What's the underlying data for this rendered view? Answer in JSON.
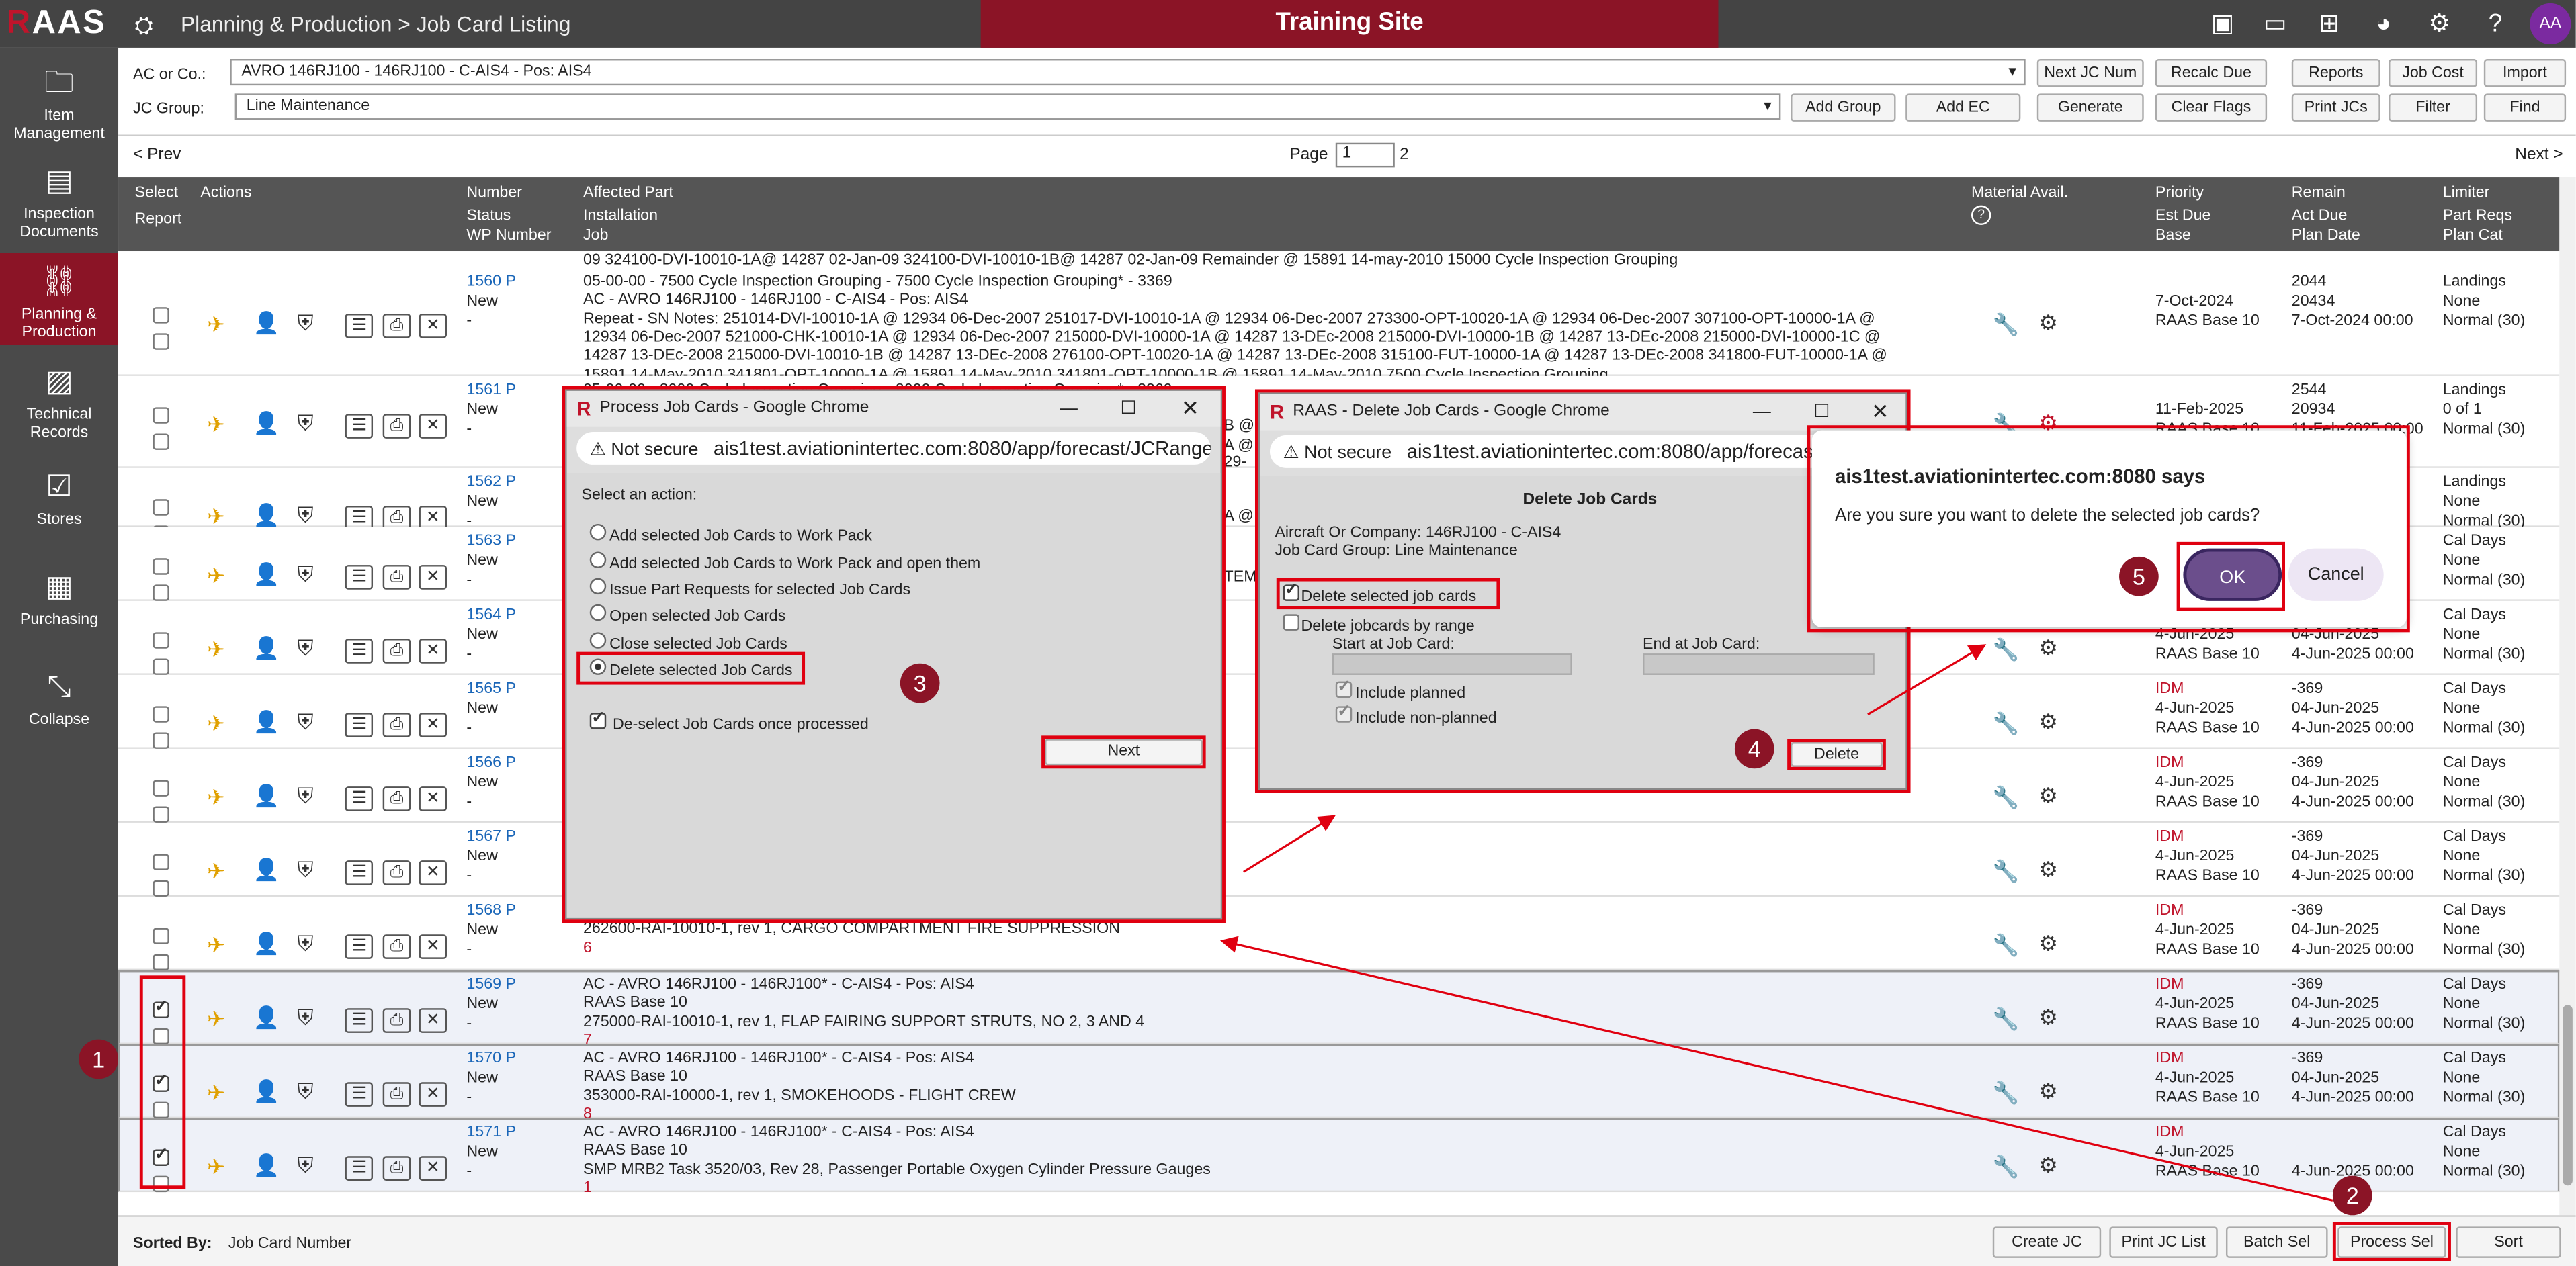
{
  "app": {
    "logo": "RAAS",
    "crumb": "Planning & Production > Job Card Listing",
    "training": "Training Site",
    "avatar": "AA"
  },
  "sidebar": [
    {
      "label1": "Item",
      "label2": "Management",
      "icon": "folder-icon"
    },
    {
      "label1": "Inspection",
      "label2": "Documents",
      "icon": "document-icon"
    },
    {
      "label1": "Planning &",
      "label2": "Production",
      "icon": "network-icon"
    },
    {
      "label1": "Technical",
      "label2": "Records",
      "icon": "chart-icon"
    },
    {
      "label1": "Stores",
      "label2": "",
      "icon": "clipboard-icon"
    },
    {
      "label1": "Purchasing",
      "label2": "",
      "icon": "calculator-icon"
    },
    {
      "label1": "Collapse",
      "label2": "",
      "icon": "collapse-icon"
    }
  ],
  "filters": {
    "ac_label": "AC or Co.:",
    "ac_value": "AVRO 146RJ100 - 146RJ100 - C-AIS4 - Pos: AIS4",
    "jc_label": "JC Group:",
    "jc_value": "Line Maintenance",
    "buttons": [
      "Next JC Num",
      "Recalc Due",
      "Reports",
      "Job Cost",
      "Import",
      "Add Group",
      "Add EC",
      "Generate",
      "Clear Flags",
      "Print JCs",
      "Filter",
      "Find"
    ]
  },
  "pager": {
    "prev": "< Prev",
    "next": "Next >",
    "page_label": "Page",
    "page": "1",
    "total": "2"
  },
  "header": {
    "select": "Select",
    "actions": "Actions",
    "report": "Report",
    "number": "Number",
    "status": "Status",
    "wp": "WP Number",
    "affected": "Affected Part",
    "installation": "Installation",
    "job": "Job",
    "material": "Material Avail.",
    "help": "?",
    "priority": "Priority",
    "estdue": "Est Due",
    "base": "Base",
    "remain": "Remain",
    "actdue": "Act Due",
    "plandate": "Plan Date",
    "limiter": "Limiter",
    "partreqs": "Part Reqs",
    "plancat": "Plan Cat"
  },
  "toptext": "09 324100-DVI-10010-1A@ 14287 02-Jan-09 324100-DVI-10010-1B@ 14287 02-Jan-09 Remainder @ 15891 14-may-2010 15000 Cycle Inspection Grouping",
  "rows": [
    {
      "num": "1560 P",
      "status": "New",
      "wp": "-",
      "lines": [
        "05-00-00 - 7500 Cycle Inspection Grouping - 7500 Cycle Inspection Grouping* - 3369",
        "AC - AVRO 146RJ100 - 146RJ100 - C-AIS4 - Pos: AIS4",
        "Repeat - SN Notes: 251014-DVI-10010-1A @ 12934 06-Dec-2007 251017-DVI-10010-1A @ 12934 06-Dec-2007 273300-OPT-10020-1A @ 12934 06-Dec-2007 307100-OPT-10000-1A @",
        "12934 06-Dec-2007 521000-CHK-10010-1A @ 12934 06-Dec-2007 215000-DVI-10000-1A @ 14287 13-DEc-2008 215000-DVI-10000-1B @ 14287 13-DEc-2008 215000-DVI-10000-1C @",
        "14287 13-DEc-2008 215000-DVI-10010-1B @ 14287 13-DEc-2008 276100-OPT-10020-1A @ 14287 13-DEc-2008 315100-FUT-10000-1A @ 14287 13-DEc-2008 341800-FUT-10000-1A @",
        "15891 14-May-2010 341801-OPT-10000-1A @ 15891 14-May-2010 341801-OPT-10000-1B @ 15891 14-May-2010 7500 Cycle Inspection Grouping"
      ],
      "pri": "",
      "due": "7-Oct-2024",
      "base": "RAAS Base 10",
      "rem": "2044",
      "act": "20434",
      "plan": "7-Oct-2024 00:00",
      "lim": "Landings",
      "preq": "None",
      "pcat": "Normal (30)"
    },
    {
      "num": "1561 P",
      "status": "New",
      "wp": "-",
      "lines": [
        "05-00-00 - 8000 Cycle Inspection Grouping - 8000 Cycle Inspection Grouping* - 3369"
      ],
      "pri": "",
      "due": "11-Feb-2025",
      "base": "RAAS Base 10",
      "rem": "2544",
      "act": "20934",
      "plan": "11-Feb-2025 00:00",
      "lim": "Landings",
      "preq": "0 of 1",
      "pcat": "Normal (30)"
    },
    {
      "num": "1562 P",
      "status": "New",
      "wp": "-",
      "lines": [],
      "pri": "",
      "due": "",
      "base": "",
      "rem": "",
      "act": "",
      "plan": "",
      "lim": "Landings",
      "preq": "None",
      "pcat": "Normal (30)"
    },
    {
      "num": "1563 P",
      "status": "New",
      "wp": "-",
      "lines": [],
      "pri": "",
      "due": "",
      "base": "",
      "rem": "",
      "act": "",
      "plan": "",
      "lim": "Cal Days",
      "preq": "None",
      "pcat": "Normal (30)"
    },
    {
      "num": "1564 P",
      "status": "New",
      "wp": "-",
      "lines": [],
      "pri": "",
      "due": "4-Jun-2025",
      "base": "RAAS Base 10",
      "rem": "",
      "act": "04-Jun-2025",
      "plan": "4-Jun-2025 00:00",
      "lim": "Cal Days",
      "preq": "None",
      "pcat": "Normal (30)"
    },
    {
      "num": "1565 P",
      "status": "New",
      "wp": "-",
      "lines": [],
      "pri": "IDM",
      "due": "4-Jun-2025",
      "base": "RAAS Base 10",
      "rem": "-369",
      "act": "04-Jun-2025",
      "plan": "4-Jun-2025 00:00",
      "lim": "Cal Days",
      "preq": "None",
      "pcat": "Normal (30)"
    },
    {
      "num": "1566 P",
      "status": "New",
      "wp": "-",
      "lines": [],
      "pri": "IDM",
      "due": "4-Jun-2025",
      "base": "RAAS Base 10",
      "rem": "-369",
      "act": "04-Jun-2025",
      "plan": "4-Jun-2025 00:00",
      "lim": "Cal Days",
      "preq": "None",
      "pcat": "Normal (30)"
    },
    {
      "num": "1567 P",
      "status": "New",
      "wp": "-",
      "lines": [],
      "pri": "IDM",
      "due": "4-Jun-2025",
      "base": "RAAS Base 10",
      "rem": "-369",
      "act": "04-Jun-2025",
      "plan": "4-Jun-2025 00:00",
      "lim": "Cal Days",
      "preq": "None",
      "pcat": "Normal (30)"
    },
    {
      "num": "1568 P",
      "status": "New",
      "wp": "-",
      "lines": [
        "RAAS Base 10",
        "262600-RAI-10010-1, rev 1, CARGO COMPARTMENT FIRE SUPPRESSION",
        "6"
      ],
      "pri": "IDM",
      "due": "4-Jun-2025",
      "base": "RAAS Base 10",
      "rem": "-369",
      "act": "04-Jun-2025",
      "plan": "4-Jun-2025 00:00",
      "lim": "Cal Days",
      "preq": "None",
      "pcat": "Normal (30)"
    },
    {
      "num": "1569 P",
      "status": "New",
      "wp": "-",
      "lines": [
        "AC - AVRO 146RJ100 - 146RJ100* - C-AIS4 - Pos: AIS4",
        "RAAS Base 10",
        "275000-RAI-10010-1, rev 1, FLAP FAIRING SUPPORT STRUTS, NO 2, 3 AND 4",
        "7"
      ],
      "pri": "IDM",
      "due": "4-Jun-2025",
      "base": "RAAS Base 10",
      "rem": "-369",
      "act": "04-Jun-2025",
      "plan": "4-Jun-2025 00:00",
      "lim": "Cal Days",
      "preq": "None",
      "pcat": "Normal (30)"
    },
    {
      "num": "1570 P",
      "status": "New",
      "wp": "-",
      "lines": [
        "AC - AVRO 146RJ100 - 146RJ100* - C-AIS4 - Pos: AIS4",
        "RAAS Base 10",
        "353000-RAI-10000-1, rev 1, SMOKEHOODS - FLIGHT CREW",
        "8"
      ],
      "pri": "IDM",
      "due": "4-Jun-2025",
      "base": "RAAS Base 10",
      "rem": "-369",
      "act": "04-Jun-2025",
      "plan": "4-Jun-2025 00:00",
      "lim": "Cal Days",
      "preq": "None",
      "pcat": "Normal (30)"
    },
    {
      "num": "1571 P",
      "status": "New",
      "wp": "-",
      "lines": [
        "AC - AVRO 146RJ100 - 146RJ100* - C-AIS4 - Pos: AIS4",
        "RAAS Base 10",
        "SMP MRB2 Task 3520/03, Rev 28, Passenger Portable Oxygen Cylinder Pressure Gauges",
        "1"
      ],
      "pri": "IDM",
      "due": "4-Jun-2025",
      "base": "RAAS Base 10",
      "rem": "",
      "act": "",
      "plan": "4-Jun-2025 00:00",
      "lim": "Cal Days",
      "preq": "None",
      "pcat": "Normal (30)"
    }
  ],
  "partial": {
    "a": "B @",
    "b": "A @",
    "c": "29-",
    "d": "A @",
    "e": "TEM",
    "f": "05-00-00 - 8000 Cycle Inspection Grouping - 8000 Cycle Inspection Grouping* - 3369"
  },
  "bottom": {
    "sorted_label": "Sorted By:",
    "sorted_value": "Job Card Number",
    "buttons": [
      "Create JC",
      "Print JC List",
      "Batch Sel",
      "Process Sel",
      "Sort"
    ]
  },
  "dlg1": {
    "title": "Process Job Cards - Google Chrome",
    "secure": "Not secure",
    "url": "ais1test.aviationintertec.com:8080/app/forecast/JCRange...",
    "prompt": "Select an action:",
    "options": [
      "Add selected Job Cards to Work Pack",
      "Add selected Job Cards to Work Pack and open them",
      "Issue Part Requests for selected Job Cards",
      "Open selected Job Cards",
      "Close selected Job Cards",
      "Delete selected Job Cards"
    ],
    "deselect": "De-select Job Cards once processed",
    "next": "Next"
  },
  "dlg2": {
    "title": "RAAS - Delete Job Cards - Google Chrome",
    "secure": "Not secure",
    "url": "ais1test.aviationintertec.com:8080/app/forecast/JC",
    "heading": "Delete Job Cards",
    "aircraft": "Aircraft Or Company: 146RJ100 - C-AIS4",
    "group": "Job Card Group: Line Maintenance",
    "opt1": "Delete selected job cards",
    "opt2": "Delete jobcards by range",
    "start": "Start at Job Card:",
    "end": "End at Job Card:",
    "inc1": "Include planned",
    "inc2": "Include non-planned",
    "delete": "Delete"
  },
  "dlg3": {
    "site": "ais1test.aviationintertec.com:8080 says",
    "msg": "Are you sure you want to delete the selected job cards?",
    "ok": "OK",
    "cancel": "Cancel"
  },
  "badges": [
    "1",
    "2",
    "3",
    "4",
    "5"
  ],
  "colors": {
    "brand": "#8b1426",
    "highlight": "#e00010",
    "link": "#1a66b8"
  }
}
